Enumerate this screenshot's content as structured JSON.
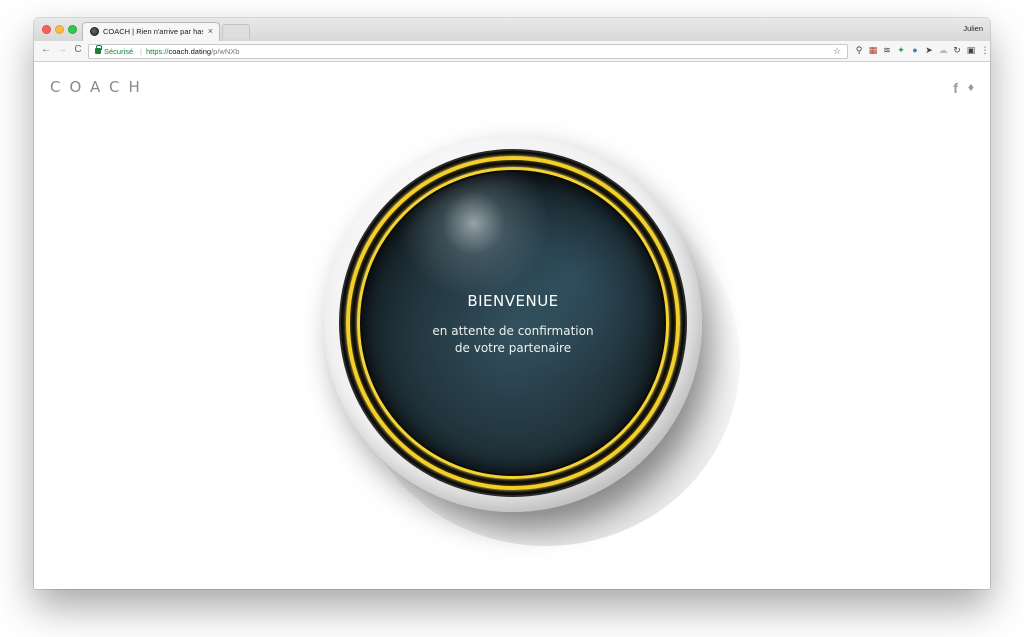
{
  "browser": {
    "tab": {
      "title": "COACH | Rien n'arrive par has",
      "close": "×"
    },
    "profile_name": "Julien",
    "nav": {
      "back": "←",
      "forward": "→",
      "reload": "C"
    },
    "address_bar": {
      "secure_label": "Sécurisé",
      "separator": "|",
      "scheme": "https://",
      "host": "coach.dating",
      "path": "/p/wNXb",
      "bookmark_star": "☆"
    },
    "extensions": [
      "magnifier-icon",
      "calendar-icon",
      "layers-icon",
      "puzzle-icon",
      "globe-icon",
      "pointer-icon",
      "cloud-icon",
      "sync-icon",
      "window-icon",
      "menu-icon"
    ]
  },
  "page": {
    "logo": "COACH",
    "social": {
      "facebook": "f",
      "twitter": "🐦"
    },
    "medallion": {
      "title": "BIENVENUE",
      "line1": "en attente de confirmation",
      "line2": "de votre partenaire"
    }
  },
  "colors": {
    "ring": "#f2cf2a",
    "face": "#22363f",
    "secure": "#188038"
  }
}
